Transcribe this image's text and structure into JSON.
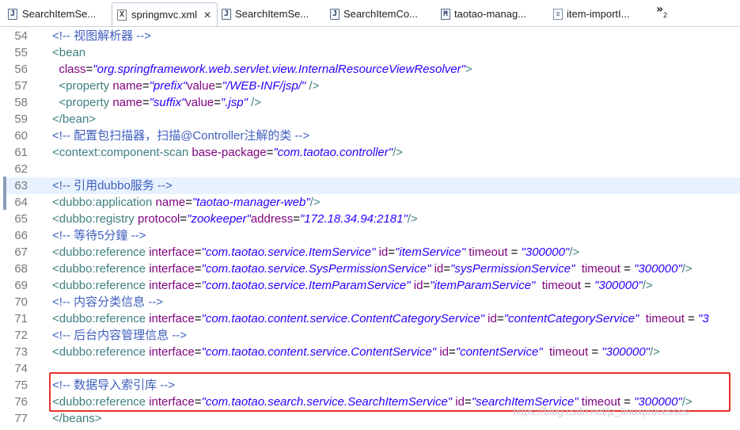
{
  "tabs": [
    {
      "label": "SearchItemSe...",
      "icon": "java-file-icon",
      "active": false
    },
    {
      "label": "springmvc.xml",
      "icon": "xml-file-icon",
      "active": true,
      "close": "✕"
    },
    {
      "label": "SearchItemSe...",
      "icon": "java-file-icon",
      "active": false
    },
    {
      "label": "SearchItemCo...",
      "icon": "java-file-icon",
      "active": false
    },
    {
      "label": "taotao-manag...",
      "icon": "maven-pom-icon",
      "active": false
    },
    {
      "label": "item-importI...",
      "icon": "properties-file-icon",
      "active": false
    }
  ],
  "overflow": {
    "chevron": "»",
    "count": "2"
  },
  "editor": {
    "current_line": "63",
    "highlighted_lines": [
      "75",
      "76"
    ],
    "lines": [
      {
        "n": "54",
        "tokens": [
          {
            "t": "c",
            "s": "<!-- 视图解析器 -->"
          }
        ]
      },
      {
        "n": "55",
        "tokens": [
          {
            "t": "g",
            "s": "<bean"
          }
        ]
      },
      {
        "n": "56",
        "tokens": [
          {
            "t": "x",
            "s": "  "
          },
          {
            "t": "a",
            "s": "class"
          },
          {
            "t": "x",
            "s": "="
          },
          {
            "t": "v",
            "s": "\"org.springframework.web.servlet.view.InternalResourceViewResolver\""
          },
          {
            "t": "g",
            "s": ">"
          }
        ]
      },
      {
        "n": "57",
        "tokens": [
          {
            "t": "x",
            "s": "  "
          },
          {
            "t": "g",
            "s": "<property"
          },
          {
            "t": "x",
            "s": " "
          },
          {
            "t": "a",
            "s": "name"
          },
          {
            "t": "x",
            "s": "="
          },
          {
            "t": "v",
            "s": "\"prefix\""
          },
          {
            "t": "a",
            "s": "value"
          },
          {
            "t": "x",
            "s": "="
          },
          {
            "t": "v",
            "s": "\"/WEB-INF/jsp/\""
          },
          {
            "t": "x",
            "s": " "
          },
          {
            "t": "g",
            "s": "/>"
          }
        ]
      },
      {
        "n": "58",
        "tokens": [
          {
            "t": "x",
            "s": "  "
          },
          {
            "t": "g",
            "s": "<property"
          },
          {
            "t": "x",
            "s": " "
          },
          {
            "t": "a",
            "s": "name"
          },
          {
            "t": "x",
            "s": "="
          },
          {
            "t": "v",
            "s": "\"suffix\""
          },
          {
            "t": "a",
            "s": "value"
          },
          {
            "t": "x",
            "s": "="
          },
          {
            "t": "v",
            "s": "\".jsp\""
          },
          {
            "t": "x",
            "s": " "
          },
          {
            "t": "g",
            "s": "/>"
          }
        ]
      },
      {
        "n": "59",
        "tokens": [
          {
            "t": "g",
            "s": "</bean>"
          }
        ]
      },
      {
        "n": "60",
        "tokens": [
          {
            "t": "c",
            "s": "<!-- 配置包扫描器，扫描@Controller注解的类 -->"
          }
        ]
      },
      {
        "n": "61",
        "tokens": [
          {
            "t": "g",
            "s": "<context:component-scan"
          },
          {
            "t": "x",
            "s": " "
          },
          {
            "t": "a",
            "s": "base-package"
          },
          {
            "t": "x",
            "s": "="
          },
          {
            "t": "v",
            "s": "\"com.taotao.controller\""
          },
          {
            "t": "g",
            "s": "/>"
          }
        ]
      },
      {
        "n": "62",
        "tokens": []
      },
      {
        "n": "63",
        "tokens": [
          {
            "t": "c",
            "s": "<!-- 引用dubbo服务 -->"
          }
        ]
      },
      {
        "n": "64",
        "tokens": [
          {
            "t": "g",
            "s": "<dubbo:application"
          },
          {
            "t": "x",
            "s": " "
          },
          {
            "t": "a",
            "s": "name"
          },
          {
            "t": "x",
            "s": "="
          },
          {
            "t": "v",
            "s": "\"taotao-manager-web\""
          },
          {
            "t": "g",
            "s": "/>"
          }
        ]
      },
      {
        "n": "65",
        "tokens": [
          {
            "t": "g",
            "s": "<dubbo:registry"
          },
          {
            "t": "x",
            "s": " "
          },
          {
            "t": "a",
            "s": "protocol"
          },
          {
            "t": "x",
            "s": "="
          },
          {
            "t": "v",
            "s": "\"zookeeper\""
          },
          {
            "t": "a",
            "s": "address"
          },
          {
            "t": "x",
            "s": "="
          },
          {
            "t": "v",
            "s": "\"172.18.34.94:2181\""
          },
          {
            "t": "g",
            "s": "/>"
          }
        ]
      },
      {
        "n": "66",
        "tokens": [
          {
            "t": "c",
            "s": "<!-- 等待5分鐘 -->"
          }
        ]
      },
      {
        "n": "67",
        "tokens": [
          {
            "t": "g",
            "s": "<dubbo:reference"
          },
          {
            "t": "x",
            "s": " "
          },
          {
            "t": "a",
            "s": "interface"
          },
          {
            "t": "x",
            "s": "="
          },
          {
            "t": "v",
            "s": "\"com.taotao.service.ItemService\""
          },
          {
            "t": "x",
            "s": " "
          },
          {
            "t": "a",
            "s": "id"
          },
          {
            "t": "x",
            "s": "="
          },
          {
            "t": "v",
            "s": "\"itemService\""
          },
          {
            "t": "x",
            "s": " "
          },
          {
            "t": "a",
            "s": "timeout"
          },
          {
            "t": "x",
            "s": " = "
          },
          {
            "t": "v",
            "s": "\"300000\""
          },
          {
            "t": "g",
            "s": "/>"
          }
        ]
      },
      {
        "n": "68",
        "tokens": [
          {
            "t": "g",
            "s": "<dubbo:reference"
          },
          {
            "t": "x",
            "s": " "
          },
          {
            "t": "a",
            "s": "interface"
          },
          {
            "t": "x",
            "s": "="
          },
          {
            "t": "v",
            "s": "\"com.taotao.service.SysPermissionService\""
          },
          {
            "t": "x",
            "s": " "
          },
          {
            "t": "a",
            "s": "id"
          },
          {
            "t": "x",
            "s": "="
          },
          {
            "t": "v",
            "s": "\"sysPermissionService\""
          },
          {
            "t": "x",
            "s": "  "
          },
          {
            "t": "a",
            "s": "timeout"
          },
          {
            "t": "x",
            "s": " = "
          },
          {
            "t": "v",
            "s": "\"300000\""
          },
          {
            "t": "g",
            "s": "/>"
          }
        ]
      },
      {
        "n": "69",
        "tokens": [
          {
            "t": "g",
            "s": "<dubbo:reference"
          },
          {
            "t": "x",
            "s": " "
          },
          {
            "t": "a",
            "s": "interface"
          },
          {
            "t": "x",
            "s": "="
          },
          {
            "t": "v",
            "s": "\"com.taotao.service.ItemParamService\""
          },
          {
            "t": "x",
            "s": " "
          },
          {
            "t": "a",
            "s": "id"
          },
          {
            "t": "x",
            "s": "="
          },
          {
            "t": "v",
            "s": "\"itemParamService\""
          },
          {
            "t": "x",
            "s": "  "
          },
          {
            "t": "a",
            "s": "timeout"
          },
          {
            "t": "x",
            "s": " = "
          },
          {
            "t": "v",
            "s": "\"300000\""
          },
          {
            "t": "g",
            "s": "/>"
          }
        ]
      },
      {
        "n": "70",
        "tokens": [
          {
            "t": "c",
            "s": "<!-- 内容分类信息 -->"
          }
        ]
      },
      {
        "n": "71",
        "tokens": [
          {
            "t": "g",
            "s": "<dubbo:reference"
          },
          {
            "t": "x",
            "s": " "
          },
          {
            "t": "a",
            "s": "interface"
          },
          {
            "t": "x",
            "s": "="
          },
          {
            "t": "v",
            "s": "\"com.taotao.content.service.ContentCategoryService\""
          },
          {
            "t": "x",
            "s": " "
          },
          {
            "t": "a",
            "s": "id"
          },
          {
            "t": "x",
            "s": "="
          },
          {
            "t": "v",
            "s": "\"contentCategoryService\""
          },
          {
            "t": "x",
            "s": "  "
          },
          {
            "t": "a",
            "s": "timeout"
          },
          {
            "t": "x",
            "s": " = "
          },
          {
            "t": "v",
            "s": "\"3"
          }
        ]
      },
      {
        "n": "72",
        "tokens": [
          {
            "t": "c",
            "s": "<!-- 后台内容管理信息 -->"
          }
        ]
      },
      {
        "n": "73",
        "tokens": [
          {
            "t": "g",
            "s": "<dubbo:reference"
          },
          {
            "t": "x",
            "s": " "
          },
          {
            "t": "a",
            "s": "interface"
          },
          {
            "t": "x",
            "s": "="
          },
          {
            "t": "v",
            "s": "\"com.taotao.content.service.ContentService\""
          },
          {
            "t": "x",
            "s": " "
          },
          {
            "t": "a",
            "s": "id"
          },
          {
            "t": "x",
            "s": "="
          },
          {
            "t": "v",
            "s": "\"contentService\""
          },
          {
            "t": "x",
            "s": "  "
          },
          {
            "t": "a",
            "s": "timeout"
          },
          {
            "t": "x",
            "s": " = "
          },
          {
            "t": "v",
            "s": "\"300000\""
          },
          {
            "t": "g",
            "s": "/>"
          }
        ]
      },
      {
        "n": "74",
        "tokens": []
      },
      {
        "n": "75",
        "tokens": [
          {
            "t": "c",
            "s": "<!-- 数据导入索引库 -->"
          }
        ]
      },
      {
        "n": "76",
        "tokens": [
          {
            "t": "g",
            "s": "<dubbo:reference"
          },
          {
            "t": "x",
            "s": " "
          },
          {
            "t": "a",
            "s": "interface"
          },
          {
            "t": "x",
            "s": "="
          },
          {
            "t": "v",
            "s": "\"com.taotao.search.service.SearchItemService\""
          },
          {
            "t": "x",
            "s": " "
          },
          {
            "t": "a",
            "s": "id"
          },
          {
            "t": "x",
            "s": "="
          },
          {
            "t": "v",
            "s": "\"searchItemService\""
          },
          {
            "t": "x",
            "s": " "
          },
          {
            "t": "a",
            "s": "timeout"
          },
          {
            "t": "x",
            "s": " = "
          },
          {
            "t": "v",
            "s": "\"300000\""
          },
          {
            "t": "g",
            "s": "/>"
          }
        ]
      },
      {
        "n": "77",
        "tokens": [
          {
            "t": "g",
            "s": "</beans>"
          }
        ]
      }
    ]
  },
  "watermark": "https://blog.csdn.net/jz_linuxprocesses",
  "colors": {
    "comment": "#3f5fbf",
    "tag": "#3f7f7f",
    "attribute": "#7f007f",
    "value": "#2a00ff",
    "current_line_bg": "#e8f2fe",
    "highlight_border": "#e8312a"
  }
}
